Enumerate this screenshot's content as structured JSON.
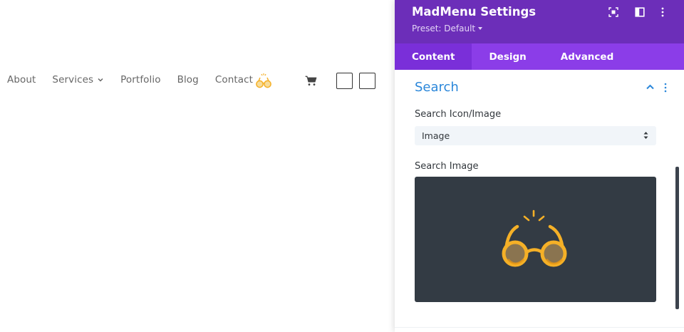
{
  "site_nav": {
    "items": [
      {
        "label": "About"
      },
      {
        "label": "Services",
        "has_dropdown": true
      },
      {
        "label": "Portfolio"
      },
      {
        "label": "Blog"
      },
      {
        "label": "Contact"
      }
    ],
    "icons": [
      "glasses-logo-icon",
      "cart-icon",
      "square-outline-icon",
      "square-outline-icon"
    ]
  },
  "panel": {
    "title": "MadMenu Settings",
    "preset": "Preset: Default",
    "header_icons": [
      "focus-icon",
      "columns-icon",
      "more-vertical-icon"
    ],
    "tabs": [
      {
        "label": "Content",
        "active": true
      },
      {
        "label": "Design",
        "active": false
      },
      {
        "label": "Advanced",
        "active": false
      }
    ],
    "section": {
      "title": "Search",
      "fields": {
        "icon_image_label": "Search Icon/Image",
        "icon_image_value": "Image",
        "search_image_label": "Search Image"
      }
    }
  },
  "colors": {
    "header_bg": "#6c2eb9",
    "tabs_bg": "#8b3de8",
    "active_tab_bg": "#7a2fd9",
    "section_title": "#2b87da",
    "image_bg": "#333b44",
    "glasses": "#f5b027"
  }
}
